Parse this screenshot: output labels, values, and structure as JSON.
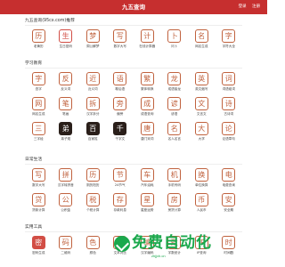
{
  "header": {
    "title": "九五查询",
    "links": [
      "登录",
      "注册"
    ]
  },
  "sections": [
    {
      "title": "九五查询(95cx.com)推荐",
      "items": [
        {
          "label": "老黄历",
          "glyph": "历",
          "color": "#c0623e",
          "style": "outline"
        },
        {
          "label": "生日密码",
          "glyph": "生",
          "color": "#d24e45",
          "style": "outline"
        },
        {
          "label": "周公解梦",
          "glyph": "梦",
          "color": "#c0623e",
          "style": "outline"
        },
        {
          "label": "数字大写",
          "glyph": "写",
          "color": "#c0623e",
          "style": "outline"
        },
        {
          "label": "在线计算器",
          "glyph": "计",
          "color": "#c0623e",
          "style": "outline"
        },
        {
          "label": "问卜",
          "glyph": "卜",
          "color": "#c0623e",
          "style": "outline"
        },
        {
          "label": "网名生成",
          "glyph": "名",
          "color": "#c0623e",
          "style": "outline"
        },
        {
          "label": "字符大全",
          "glyph": "字",
          "color": "#c0623e",
          "style": "outline"
        }
      ]
    },
    {
      "title": "学习教育",
      "items": [
        {
          "label": "查字",
          "glyph": "字",
          "color": "#c0623e",
          "style": "outline"
        },
        {
          "label": "反义词",
          "glyph": "反",
          "color": "#c0623e",
          "style": "outline"
        },
        {
          "label": "近义词",
          "glyph": "近",
          "color": "#c0623e",
          "style": "outline"
        },
        {
          "label": "歇后语",
          "glyph": "语",
          "color": "#c0623e",
          "style": "outline"
        },
        {
          "label": "繁体转换",
          "glyph": "繁",
          "color": "#c0623e",
          "style": "outline"
        },
        {
          "label": "成语接龙",
          "glyph": "龙",
          "color": "#c0623e",
          "style": "outline"
        },
        {
          "label": "英文缩写",
          "glyph": "英",
          "color": "#c0623e",
          "style": "outline"
        },
        {
          "label": "词语组词",
          "glyph": "词",
          "color": "#c0623e",
          "style": "outline"
        },
        {
          "label": "网名生成",
          "glyph": "网",
          "color": "#c0623e",
          "style": "outline"
        },
        {
          "label": "笔画",
          "glyph": "笔",
          "color": "#c0623e",
          "style": "outline"
        },
        {
          "label": "汉字拆分",
          "glyph": "拆",
          "color": "#c0623e",
          "style": "outline"
        },
        {
          "label": "偏旁",
          "glyph": "旁",
          "color": "#c0623e",
          "style": "outline"
        },
        {
          "label": "成语查询",
          "glyph": "成",
          "color": "#c0623e",
          "style": "outline"
        },
        {
          "label": "谚语",
          "glyph": "谚",
          "color": "#c0623e",
          "style": "outline"
        },
        {
          "label": "文言文",
          "glyph": "文",
          "color": "#c0623e",
          "style": "outline"
        },
        {
          "label": "古诗词",
          "glyph": "诗",
          "color": "#c0623e",
          "style": "outline"
        },
        {
          "label": "三字经",
          "glyph": "三",
          "color": "#c0623e",
          "style": "outline"
        },
        {
          "label": "弟子规",
          "glyph": "弟",
          "color": "#fff",
          "style": "dark"
        },
        {
          "label": "百家姓",
          "glyph": "百",
          "color": "#fff",
          "style": "dark"
        },
        {
          "label": "千字文",
          "glyph": "千",
          "color": "#fff",
          "style": "dark"
        },
        {
          "label": "唐门宋词",
          "glyph": "唐",
          "color": "#c0623e",
          "style": "outline"
        },
        {
          "label": "名人名言",
          "glyph": "名",
          "color": "#c0623e",
          "style": "outline"
        },
        {
          "label": "大学",
          "glyph": "大",
          "color": "#c0623e",
          "style": "outline"
        },
        {
          "label": "论语章句",
          "glyph": "论",
          "color": "#c0623e",
          "style": "outline"
        }
      ]
    },
    {
      "title": "日常生活",
      "items": [
        {
          "label": "数字大写",
          "glyph": "写",
          "color": "#c0623e",
          "style": "outline"
        },
        {
          "label": "汉字转拼音",
          "glyph": "拼",
          "color": "#c0623e",
          "style": "outline"
        },
        {
          "label": "阴历阳历",
          "glyph": "历",
          "color": "#c0623e",
          "style": "outline"
        },
        {
          "label": "24节气",
          "glyph": "节",
          "color": "#c0623e",
          "style": "outline"
        },
        {
          "label": "汽车油耗",
          "glyph": "车",
          "color": "#c0623e",
          "style": "outline"
        },
        {
          "label": "手机号码",
          "glyph": "机",
          "color": "#c0623e",
          "style": "outline"
        },
        {
          "label": "单位换算",
          "glyph": "换",
          "color": "#c0623e",
          "style": "outline"
        },
        {
          "label": "电费查询",
          "glyph": "电",
          "color": "#c0623e",
          "style": "outline"
        },
        {
          "label": "贷款计算",
          "glyph": "贷",
          "color": "#c0623e",
          "style": "outline"
        },
        {
          "label": "公积金",
          "glyph": "公",
          "color": "#c0623e",
          "style": "outline"
        },
        {
          "label": "个税计算",
          "glyph": "税",
          "color": "#c0623e",
          "style": "outline"
        },
        {
          "label": "存款利息",
          "glyph": "存",
          "color": "#c0623e",
          "style": "outline"
        },
        {
          "label": "星座运势",
          "glyph": "星",
          "color": "#c0623e",
          "style": "outline"
        },
        {
          "label": "房贷计算",
          "glyph": "房",
          "color": "#c0623e",
          "style": "outline"
        },
        {
          "label": "人民币",
          "glyph": "币",
          "color": "#c0623e",
          "style": "outline"
        },
        {
          "label": "安全期",
          "glyph": "安",
          "color": "#c0623e",
          "style": "outline"
        }
      ]
    },
    {
      "title": "实用工具",
      "items": [
        {
          "label": "密码生成",
          "glyph": "密",
          "color": "#fff",
          "style": "red"
        },
        {
          "label": "二维码",
          "glyph": "码",
          "color": "#c0623e",
          "style": "outline"
        },
        {
          "label": "颜色",
          "glyph": "色",
          "color": "#c0623e",
          "style": "outline"
        },
        {
          "label": "文本对比",
          "glyph": "文",
          "color": "#c0623e",
          "style": "outline"
        },
        {
          "label": "汉字编码",
          "glyph": "编",
          "color": "#c0623e",
          "style": "outline"
        },
        {
          "label": "字数统计",
          "glyph": "数",
          "color": "#c0623e",
          "style": "outline"
        },
        {
          "label": "IP查询",
          "glyph": "IP",
          "color": "#c0623e",
          "style": "outline"
        },
        {
          "label": "时间戳",
          "glyph": "时",
          "color": "#c0623e",
          "style": "outline"
        }
      ]
    }
  ],
  "watermark": {
    "text": "免费自动化",
    "sub": "zhjjxh.cn"
  }
}
